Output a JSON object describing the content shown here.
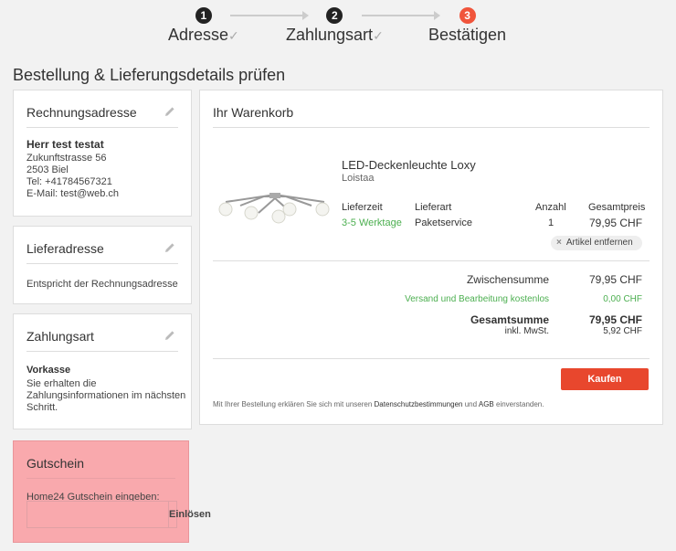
{
  "stepper": {
    "steps": [
      {
        "num": "1",
        "label": "Adresse",
        "check": "✓"
      },
      {
        "num": "2",
        "label": "Zahlungsart",
        "check": "✓"
      },
      {
        "num": "3",
        "label": "Bestätigen",
        "check": ""
      }
    ]
  },
  "page_title": "Bestellung & Lieferungsdetails prüfen",
  "billing": {
    "title": "Rechnungsadresse",
    "name": "Herr test testat",
    "street": "Zukunftstrasse 56",
    "city": "2503 Biel",
    "phone": "Tel: +41784567321",
    "email": "E-Mail: test@web.ch"
  },
  "delivery": {
    "title": "Lieferadresse",
    "text": "Entspricht der Rechnungsadresse"
  },
  "payment": {
    "title": "Zahlungsart",
    "method": "Vorkasse",
    "line1": "Sie erhalten die",
    "line2": "Zahlungsinformationen im nächsten",
    "line3": "Schritt."
  },
  "voucher": {
    "title": "Gutschein",
    "label": "Home24 Gutschein eingeben:",
    "input_value": "",
    "button": "Einlösen"
  },
  "cart": {
    "title": "Ihr Warenkorb",
    "product": {
      "name": "LED-Deckenleuchte Loxy",
      "brand": "Loistaa",
      "col_delivery_time": "Lieferzeit",
      "col_delivery_type": "Lieferart",
      "col_qty": "Anzahl",
      "col_total": "Gesamtpreis",
      "delivery_time": "3-5 Werktage",
      "delivery_type": "Paketservice",
      "qty": "1",
      "total": "79,95 CHF",
      "remove": "Artikel entfernen"
    },
    "subtotal_label": "Zwischensumme",
    "subtotal": "79,95 CHF",
    "shipping_label": "Versand und Bearbeitung kostenlos",
    "shipping": "0,00 CHF",
    "total_label": "Gesamtsumme",
    "total": "79,95 CHF",
    "vat_label": "inkl. MwSt.",
    "vat": "5,92 CHF",
    "buy_button": "Kaufen",
    "legal_pre": "Mit Ihrer Bestellung erklären Sie sich mit unseren",
    "legal_link1": "Datenschutzbestimmungen",
    "legal_mid": "und",
    "legal_link2": "AGB",
    "legal_post": "einverstanden."
  },
  "colors": {
    "accent": "#f0543b",
    "buy": "#e8472d",
    "green": "#4caf50",
    "voucher_bg": "#f9a9ad"
  },
  "icons": [
    "pencil-icon",
    "close-icon",
    "check-icon"
  ]
}
